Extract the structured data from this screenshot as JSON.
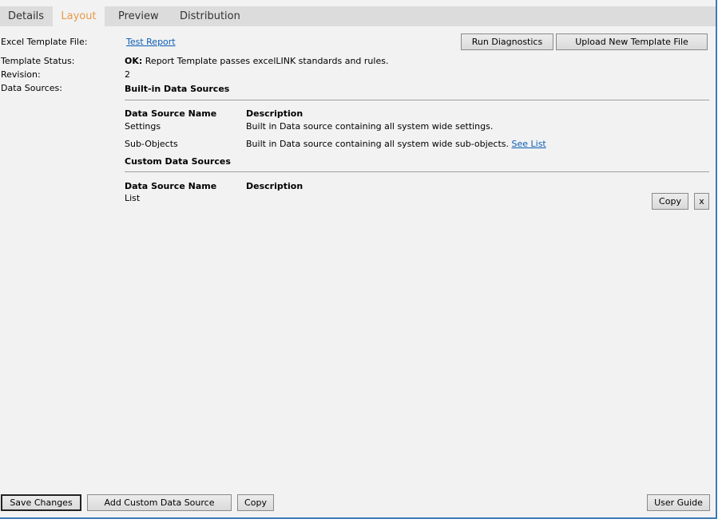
{
  "tabs": [
    {
      "label": "Details"
    },
    {
      "label": "Layout"
    },
    {
      "label": "Preview"
    },
    {
      "label": "Distribution"
    }
  ],
  "fields": {
    "template_file_label": "Excel Template File:",
    "template_file_link": "Test Report",
    "status_label": "Template Status:",
    "status_ok": "OK:",
    "status_text": "Report Template passes excelLINK standards and rules.",
    "revision_label": "Revision:",
    "revision_value": "2",
    "data_sources_label": "Data Sources:"
  },
  "toolbar": {
    "run_diagnostics": "Run Diagnostics",
    "upload_template": "Upload New Template File"
  },
  "builtin": {
    "title": "Built-in Data Sources",
    "col_name": "Data Source Name",
    "col_desc": "Description",
    "rows": [
      {
        "name": "Settings",
        "description": "Built in Data source containing all system wide settings.",
        "link": ""
      },
      {
        "name": "Sub-Objects",
        "description": "Built in Data source containing all system wide sub-objects.",
        "link": "See List"
      }
    ]
  },
  "custom": {
    "title": "Custom Data Sources",
    "col_name": "Data Source Name",
    "col_desc": "Description",
    "rows": [
      {
        "name": "List",
        "description": "",
        "copy_label": "Copy",
        "remove_label": "x"
      }
    ]
  },
  "footer": {
    "save_changes": "Save Changes",
    "add_custom": "Add Custom Data Source",
    "copy": "Copy",
    "user_guide": "User Guide"
  }
}
